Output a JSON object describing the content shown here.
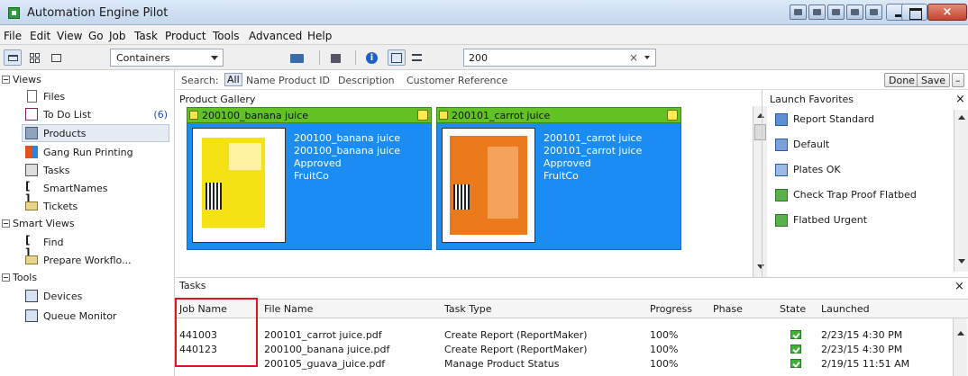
{
  "window": {
    "title": "Automation Engine Pilot"
  },
  "menu": [
    "File",
    "Edit",
    "View",
    "Go",
    "Job",
    "Task",
    "Product",
    "Tools",
    "Advanced",
    "Help"
  ],
  "toolbar": {
    "container_select": "Containers",
    "search_value": "200",
    "clear_glyph": "×"
  },
  "sidebar": {
    "views_label": "Views",
    "views": [
      {
        "label": "Files",
        "icon": "file-icon"
      },
      {
        "label": "To Do List",
        "icon": "todo-list-icon",
        "count": "(6)"
      },
      {
        "label": "Products",
        "icon": "products-icon",
        "selected": true
      },
      {
        "label": "Gang Run Printing",
        "icon": "gang-run-icon"
      },
      {
        "label": "Tasks",
        "icon": "tasks-icon"
      },
      {
        "label": "SmartNames",
        "icon": "smartnames-icon"
      },
      {
        "label": "Tickets",
        "icon": "tickets-icon"
      }
    ],
    "smart_views_label": "Smart Views",
    "smart_views": [
      {
        "label": "Find",
        "icon": "find-icon"
      },
      {
        "label": "Prepare Workflo...",
        "icon": "prepare-workflow-icon"
      }
    ],
    "tools_label": "Tools",
    "tools": [
      {
        "label": "Devices",
        "icon": "devices-icon"
      },
      {
        "label": "Queue Monitor",
        "icon": "queue-monitor-icon"
      }
    ]
  },
  "search": {
    "label": "Search:",
    "filters": [
      "All",
      "Name",
      "Product ID",
      "Description",
      "Customer Reference"
    ],
    "active_filter": "All",
    "done_label": "Done",
    "save_label": "Save",
    "collapse_label": "–"
  },
  "gallery": {
    "title": "Product Gallery",
    "cards": [
      {
        "header": "200100_banana juice",
        "lines": [
          "200100_banana juice",
          "200100_banana juice",
          "Approved",
          "FruitCo"
        ],
        "thumb_color": "#f5e214"
      },
      {
        "header": "200101_carrot juice",
        "lines": [
          "200101_carrot juice",
          "200101_carrot juice",
          "Approved",
          "FruitCo"
        ],
        "thumb_color": "#ea7a1c"
      }
    ]
  },
  "launch": {
    "title": "Launch Favorites",
    "close": "×",
    "items": [
      {
        "label": "Report Standard",
        "icon": "report-icon"
      },
      {
        "label": "Default",
        "icon": "default-icon"
      },
      {
        "label": "Plates OK",
        "icon": "plates-icon"
      },
      {
        "label": "Check Trap Proof Flatbed",
        "icon": "check-trap-icon"
      },
      {
        "label": "Flatbed Urgent",
        "icon": "flatbed-icon"
      }
    ]
  },
  "tasks": {
    "title": "Tasks",
    "close": "×",
    "columns": [
      "Job Name",
      "File Name",
      "Task Type",
      "Progress",
      "Phase",
      "State",
      "Launched"
    ],
    "rows": [
      {
        "job": "441003",
        "file": "200101_carrot juice.pdf",
        "type": "Create Report (ReportMaker)",
        "progress": "100%",
        "phase": "",
        "launched": "2/23/15 4:30 PM"
      },
      {
        "job": "440123",
        "file": "200100_banana juice.pdf",
        "type": "Create Report (ReportMaker)",
        "progress": "100%",
        "phase": "",
        "launched": "2/23/15 4:30 PM"
      },
      {
        "job": "",
        "file": "200105_guava_juice.pdf",
        "type": "Manage Product Status",
        "progress": "100%",
        "phase": "",
        "launched": "2/19/15 11:51 AM"
      }
    ]
  },
  "colors": {
    "accent": "#1b8df2",
    "card_header": "#62c223",
    "highlight": "#e0141c"
  }
}
